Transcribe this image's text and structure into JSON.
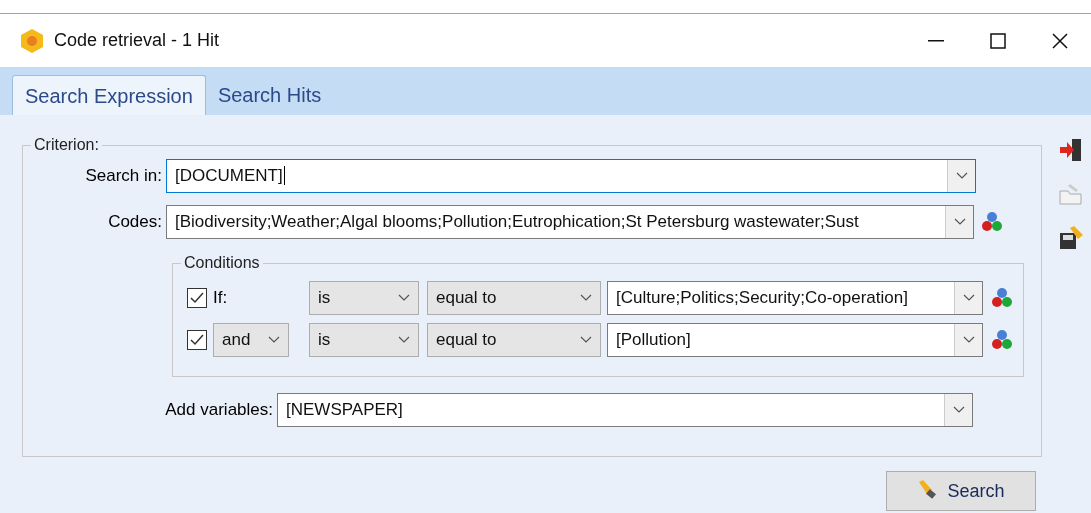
{
  "window": {
    "title": "Code retrieval - 1 Hit"
  },
  "tabs": [
    {
      "label": "Search Expression",
      "selected": true
    },
    {
      "label": "Search Hits",
      "selected": false
    }
  ],
  "criterion": {
    "label": "Criterion:",
    "search_in": {
      "label": "Search in:",
      "value": "[DOCUMENT]",
      "focused": true
    },
    "codes": {
      "label": "Codes:",
      "value": "[Biodiversity;Weather;Algal blooms;Pollution;Eutrophication;St Petersburg wastewater;Sust",
      "focused": false
    },
    "conditions": {
      "label": "Conditions",
      "rows": [
        {
          "checked": true,
          "connector": {
            "kind": "label",
            "text": "If:"
          },
          "operator": "is",
          "relation": "equal to",
          "value": "[Culture;Politics;Security;Co-operation]"
        },
        {
          "checked": true,
          "connector": {
            "kind": "dropdown",
            "text": "and"
          },
          "operator": "is",
          "relation": "equal to",
          "value": "[Pollution]"
        }
      ]
    },
    "add_variables": {
      "label": "Add variables:",
      "value": "[NEWSPAPER]",
      "focused": false
    }
  },
  "search_button": "Search"
}
